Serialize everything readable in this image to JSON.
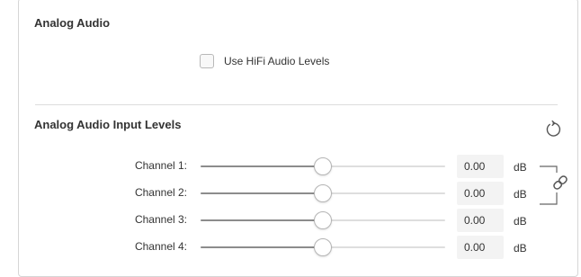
{
  "analog_audio": {
    "title": "Analog Audio",
    "hifi_checkbox": {
      "label": "Use HiFi Audio Levels",
      "checked": false
    }
  },
  "input_levels": {
    "title": "Analog Audio Input Levels",
    "reset_icon": "reset-icon",
    "link_icon": "link-icon",
    "channels": [
      {
        "label": "Channel 1:",
        "value": "0.00",
        "unit": "dB",
        "level": 0.5
      },
      {
        "label": "Channel 2:",
        "value": "0.00",
        "unit": "dB",
        "level": 0.5
      },
      {
        "label": "Channel 3:",
        "value": "0.00",
        "unit": "dB",
        "level": 0.5
      },
      {
        "label": "Channel 4:",
        "value": "0.00",
        "unit": "dB",
        "level": 0.5
      }
    ]
  },
  "colors": {
    "border": "#d6d6d6",
    "track": "#dedede",
    "track_fill": "#8c8c8c",
    "value_bg": "#f3f3f3",
    "text": "#333333"
  }
}
